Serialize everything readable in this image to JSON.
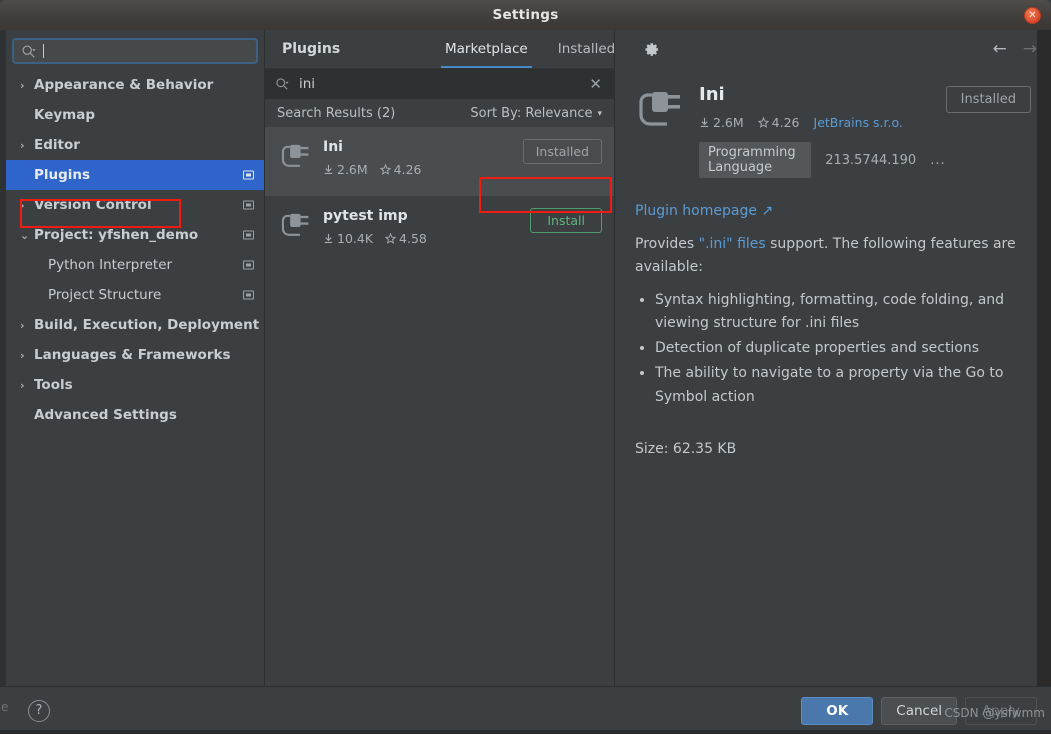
{
  "window": {
    "title": "Settings",
    "close_label": "✕"
  },
  "sidebar": {
    "search": {
      "value": "",
      "placeholder": "",
      "icon": "search-icon"
    },
    "items": [
      {
        "label": "Appearance & Behavior",
        "arrow": "›",
        "expandable": true,
        "bold": true,
        "indent": false,
        "selected": false,
        "badge": false
      },
      {
        "label": "Keymap",
        "arrow": "",
        "expandable": false,
        "bold": true,
        "indent": false,
        "selected": false,
        "badge": false
      },
      {
        "label": "Editor",
        "arrow": "›",
        "expandable": true,
        "bold": true,
        "indent": false,
        "selected": false,
        "badge": false
      },
      {
        "label": "Plugins",
        "arrow": "",
        "expandable": false,
        "bold": true,
        "indent": false,
        "selected": true,
        "badge": true
      },
      {
        "label": "Version Control",
        "arrow": "›",
        "expandable": true,
        "bold": true,
        "indent": false,
        "selected": false,
        "badge": true
      },
      {
        "label": "Project: yfshen_demo",
        "arrow": "⌄",
        "expandable": true,
        "bold": true,
        "indent": false,
        "selected": false,
        "badge": true
      },
      {
        "label": "Python Interpreter",
        "arrow": "",
        "expandable": false,
        "bold": false,
        "indent": true,
        "selected": false,
        "badge": true
      },
      {
        "label": "Project Structure",
        "arrow": "",
        "expandable": false,
        "bold": false,
        "indent": true,
        "selected": false,
        "badge": true
      },
      {
        "label": "Build, Execution, Deployment",
        "arrow": "›",
        "expandable": true,
        "bold": true,
        "indent": false,
        "selected": false,
        "badge": false
      },
      {
        "label": "Languages & Frameworks",
        "arrow": "›",
        "expandable": true,
        "bold": true,
        "indent": false,
        "selected": false,
        "badge": false
      },
      {
        "label": "Tools",
        "arrow": "›",
        "expandable": true,
        "bold": true,
        "indent": false,
        "selected": false,
        "badge": false
      },
      {
        "label": "Advanced Settings",
        "arrow": "",
        "expandable": false,
        "bold": true,
        "indent": false,
        "selected": false,
        "badge": false
      }
    ]
  },
  "plugins_panel": {
    "heading": "Plugins",
    "tabs": [
      {
        "label": "Marketplace",
        "active": true
      },
      {
        "label": "Installed",
        "active": false
      }
    ],
    "gear_icon": "gear-icon",
    "nav_back": "←",
    "nav_forward": "→",
    "search": {
      "value": "ini",
      "icon": "search-icon",
      "clear_label": "✕"
    },
    "results_label": "Search Results (2)",
    "sort_label": "Sort By: Relevance",
    "sort_chevron": "▾",
    "results": [
      {
        "name": "Ini",
        "downloads": "2.6M",
        "rating": "4.26",
        "button_label": "Installed",
        "button_state": "installed",
        "selected": true
      },
      {
        "name": "pytest imp",
        "downloads": "10.4K",
        "rating": "4.58",
        "button_label": "Install",
        "button_state": "install",
        "selected": false
      }
    ]
  },
  "detail": {
    "title": "Ini",
    "downloads": "2.6M",
    "rating": "4.26",
    "vendor": "JetBrains s.r.o.",
    "install_button": "Installed",
    "tag": "Programming Language",
    "version": "213.5744.190",
    "more": "...",
    "homepage_link": "Plugin homepage ↗",
    "description_lead_1": "Provides ",
    "description_link": "\".ini\" files",
    "description_lead_2": " support. The following features are available:",
    "features": [
      "Syntax highlighting, formatting, code folding, and viewing structure for .ini files",
      "Detection of duplicate properties and sections",
      "The ability to navigate to a property via the Go to Symbol action"
    ],
    "size": "Size: 62.35 KB"
  },
  "footer": {
    "help_label": "?",
    "ok_label": "OK",
    "cancel_label": "Cancel",
    "apply_label": "Apply"
  },
  "watermark": "CSDN @ysfwmm",
  "ghost_text": "e",
  "colors": {
    "accent_blue": "#2f65ca",
    "tab_underline": "#4a88c7",
    "link": "#5b9bd5",
    "install_green": "#5fb37f",
    "highlight_red": "#ee1c11",
    "ok_button": "#4a78ad",
    "panel_bg": "#3c3f41"
  }
}
